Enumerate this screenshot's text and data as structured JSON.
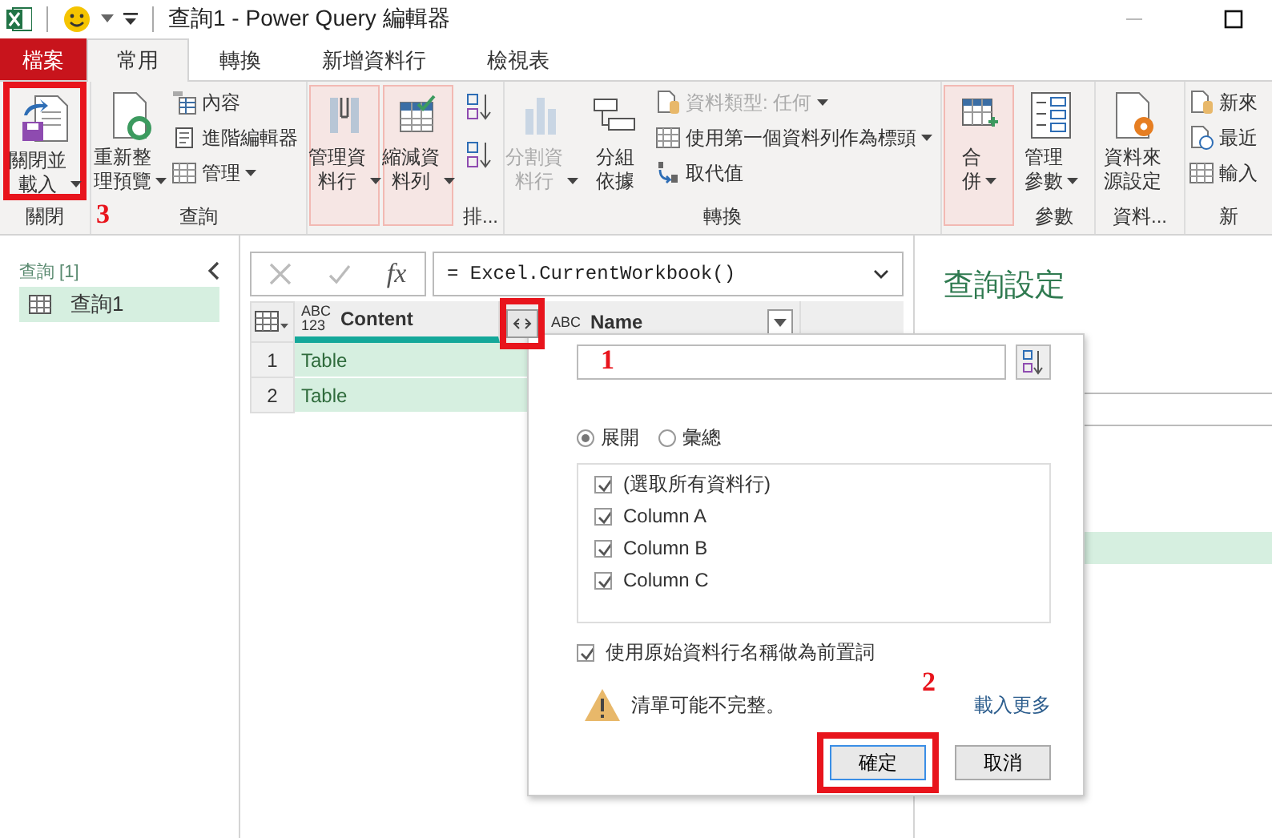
{
  "title_bar": {
    "title": "查詢1 - Power Query 編輯器"
  },
  "tabs": [
    {
      "label": "檔案",
      "kind": "file",
      "selected": false
    },
    {
      "label": "常用",
      "kind": "tab",
      "selected": true
    },
    {
      "label": "轉換",
      "kind": "tab",
      "selected": false
    },
    {
      "label": "新增資料行",
      "kind": "tab",
      "selected": false
    },
    {
      "label": "檢視表",
      "kind": "tab",
      "selected": false
    }
  ],
  "ribbon": {
    "groups": [
      {
        "label": "關閉",
        "items": [
          {
            "kind": "large",
            "label": "關閉並載入",
            "dropdown": true,
            "annotation": "3"
          }
        ]
      },
      {
        "label": "查詢",
        "items": [
          {
            "kind": "large",
            "label": "重新整理預覽",
            "dropdown": true
          },
          {
            "kind": "small",
            "label": "內容"
          },
          {
            "kind": "small",
            "label": "進階編輯器"
          },
          {
            "kind": "small",
            "label": "管理",
            "dropdown": true
          }
        ]
      },
      {
        "items": [
          {
            "kind": "large",
            "label": "管理資料行",
            "dropdown": true,
            "highlighted": true
          },
          {
            "kind": "large",
            "label": "縮減資料列",
            "dropdown": true,
            "highlighted": true
          }
        ]
      },
      {
        "label": "排...",
        "items": [
          {
            "kind": "sort"
          },
          {
            "kind": "sort"
          }
        ]
      },
      {
        "label": "轉換",
        "items": [
          {
            "kind": "large",
            "label": "分割資料行",
            "dropdown": true,
            "disabled": true
          },
          {
            "kind": "large",
            "label": "分組依據"
          },
          {
            "kind": "small",
            "label": "資料類型: 任何",
            "dropdown": true,
            "disabled": true
          },
          {
            "kind": "small",
            "label": "使用第一個資料列作為標頭",
            "dropdown": true
          },
          {
            "kind": "small",
            "label": "取代值"
          }
        ]
      },
      {
        "items": [
          {
            "kind": "large",
            "label": "合併",
            "dropdown": true,
            "highlighted": true
          }
        ]
      },
      {
        "label": "參數",
        "items": [
          {
            "kind": "large",
            "label": "管理參數",
            "dropdown": true
          }
        ]
      },
      {
        "label": "資料...",
        "items": [
          {
            "kind": "large",
            "label": "資料來源設定"
          }
        ]
      },
      {
        "label": "新",
        "items": [
          {
            "kind": "small",
            "label": "新來"
          },
          {
            "kind": "small",
            "label": "最近"
          },
          {
            "kind": "small",
            "label": "輸入"
          }
        ]
      }
    ]
  },
  "queries_pane": {
    "header": "查詢 [1]",
    "items": [
      {
        "label": "查詢1",
        "selected": true
      }
    ]
  },
  "formula_bar": {
    "fx_label": "fx",
    "formula": "= Excel.CurrentWorkbook()"
  },
  "table": {
    "columns": [
      {
        "name": "Content",
        "type_label": "ABC\n123",
        "selected": true,
        "expand_marked": true
      },
      {
        "name": "Name",
        "type_label": "ABC",
        "selected": false
      }
    ],
    "rows": [
      {
        "number": "1",
        "content": "Table"
      },
      {
        "number": "2",
        "content": "Table"
      }
    ]
  },
  "query_settings": {
    "title": "查詢設定"
  },
  "expand_popup": {
    "search_annotation": "1",
    "modes": [
      {
        "label": "展開",
        "selected": true
      },
      {
        "label": "彙總",
        "selected": false
      }
    ],
    "columns": [
      {
        "label": "(選取所有資料行)",
        "checked": true
      },
      {
        "label": "Column A",
        "checked": true
      },
      {
        "label": "Column B",
        "checked": true
      },
      {
        "label": "Column C",
        "checked": true
      }
    ],
    "prefix_option": {
      "label": "使用原始資料行名稱做為前置詞",
      "checked": true
    },
    "warning": "清單可能不完整。",
    "load_more": "載入更多",
    "buttons": [
      {
        "label": "確定",
        "kind": "primary",
        "annotation": "2"
      },
      {
        "label": "取消",
        "kind": "secondary"
      }
    ]
  }
}
